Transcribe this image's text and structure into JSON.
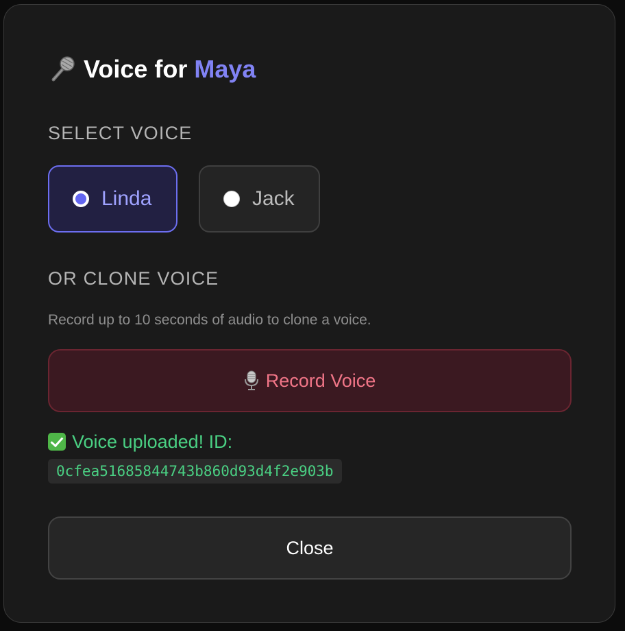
{
  "title": {
    "prefix": "Voice for",
    "name": "Maya",
    "icon": "microphone-icon"
  },
  "select_voice": {
    "label": "SELECT VOICE",
    "options": [
      {
        "label": "Linda",
        "selected": true
      },
      {
        "label": "Jack",
        "selected": false
      }
    ]
  },
  "clone_voice": {
    "label": "OR CLONE VOICE",
    "hint": "Record up to 10 seconds of audio to clone a voice.",
    "record_button": {
      "label": "Record Voice",
      "icon": "studio-microphone-icon"
    }
  },
  "status": {
    "icon": "check-mark-icon",
    "text": "Voice uploaded! ID:",
    "voice_id": "0cfea51685844743b860d93d4f2e903b"
  },
  "close_button": {
    "label": "Close"
  },
  "colors": {
    "accent": "#8183f4",
    "success": "#4ad083",
    "record": "#f07587",
    "background": "#1a1a1a"
  }
}
